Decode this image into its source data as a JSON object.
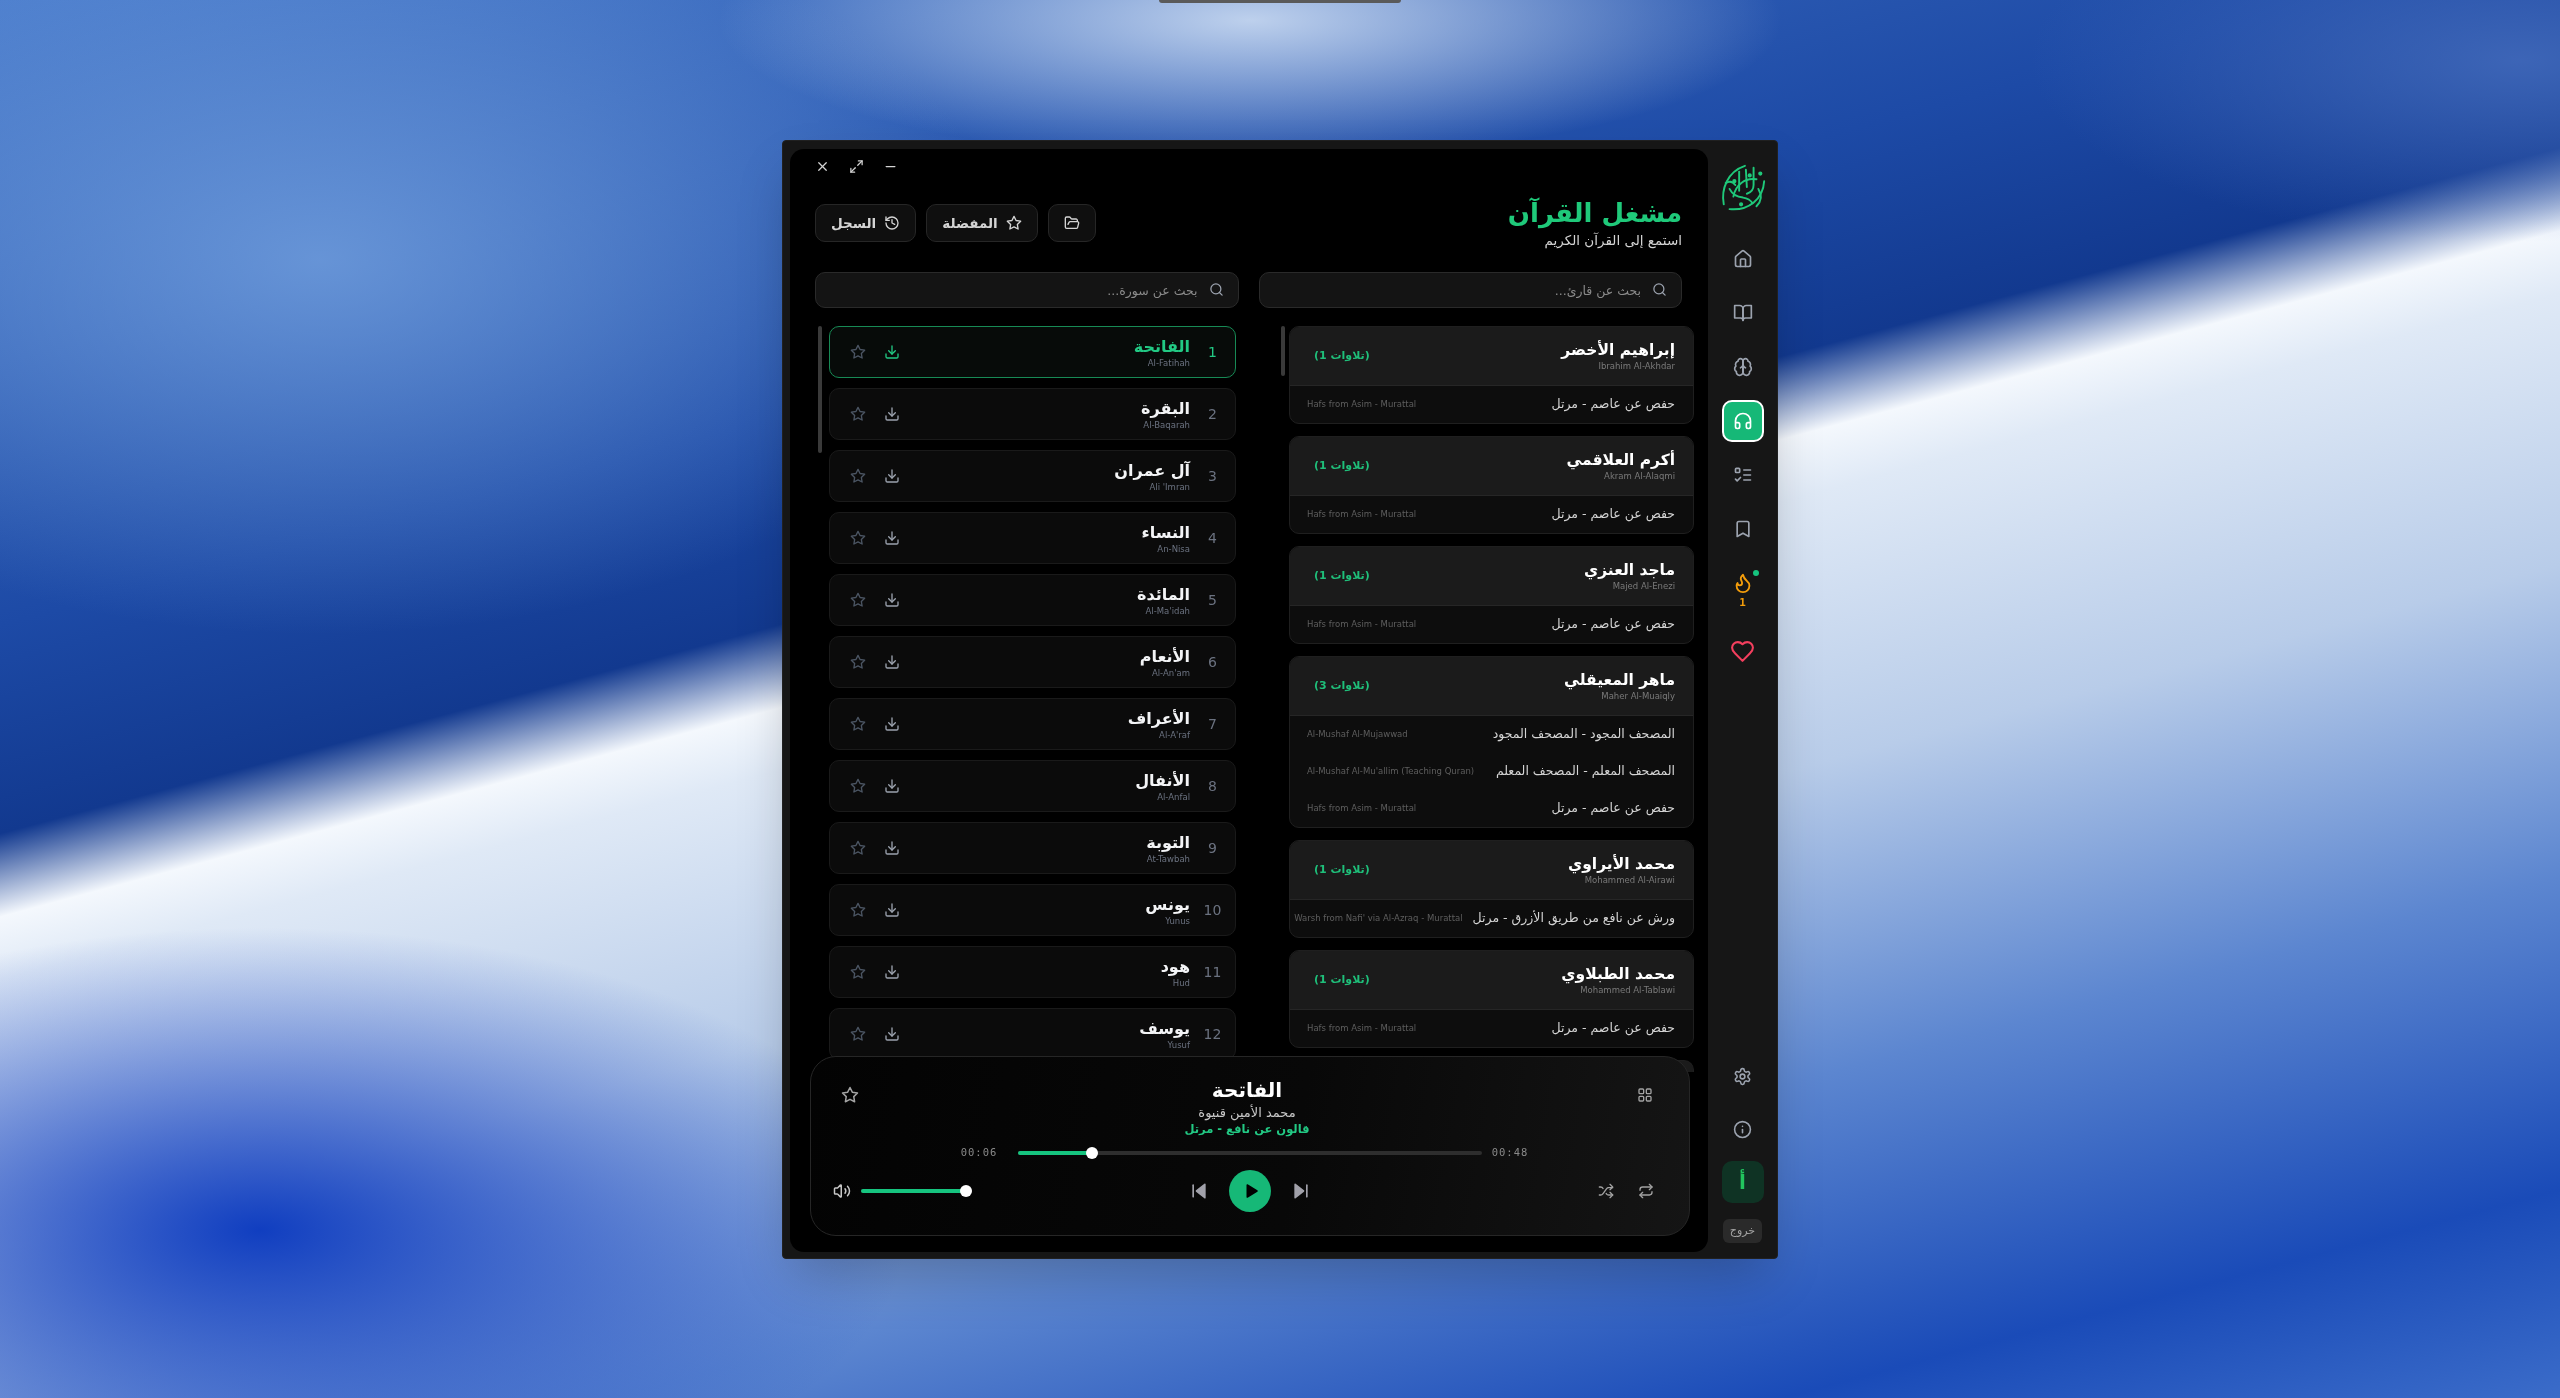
{
  "window": {
    "controls": [
      {
        "kind": "close"
      },
      {
        "kind": "maximize"
      },
      {
        "kind": "minimize"
      }
    ]
  },
  "sidebar": {
    "items": [
      {
        "kind": "home",
        "selected": false
      },
      {
        "kind": "read",
        "selected": false
      },
      {
        "kind": "learn",
        "selected": false
      },
      {
        "kind": "listen",
        "selected": true
      },
      {
        "kind": "tasks",
        "selected": false
      },
      {
        "kind": "bookmarks",
        "selected": false
      },
      {
        "kind": "streak",
        "selected": false,
        "count": "1",
        "notification": true
      },
      {
        "kind": "favorites",
        "selected": false
      }
    ],
    "footer_items": [
      {
        "kind": "settings"
      },
      {
        "kind": "about"
      }
    ],
    "profile": {
      "initial": "أ"
    },
    "logout": {
      "label": "خروج"
    }
  },
  "header": {
    "title": "مشغل القرآن",
    "subtitle": "استمع إلى القرآن الكريم",
    "buttons": [
      {
        "kind": "folder"
      },
      {
        "kind": "favorites",
        "label": "المفضلة"
      },
      {
        "kind": "history",
        "label": "السجل"
      }
    ]
  },
  "reciter_search": {
    "placeholder": "بحث عن قارئ..."
  },
  "surah_search": {
    "placeholder": "بحث عن سورة..."
  },
  "reciters": [
    {
      "name": "إبراهيم الأخضر",
      "transliteration": "Ibrahim Al-Akhdar",
      "count": "(1 تلاوات)",
      "recitations": [
        {
          "name": "حفص عن عاصم - مرتل",
          "transliteration": "Hafs from Asim - Murattal"
        }
      ]
    },
    {
      "name": "أكرم العلاقمي",
      "transliteration": "Akram Al-Alaqmi",
      "count": "(1 تلاوات)",
      "recitations": [
        {
          "name": "حفص عن عاصم - مرتل",
          "transliteration": "Hafs from Asim - Murattal"
        }
      ]
    },
    {
      "name": "ماجد العنزي",
      "transliteration": "Majed Al-Enezi",
      "count": "(1 تلاوات)",
      "recitations": [
        {
          "name": "حفص عن عاصم - مرتل",
          "transliteration": "Hafs from Asim - Murattal"
        }
      ]
    },
    {
      "name": "ماهر المعيقلي",
      "transliteration": "Maher Al-Muaiqly",
      "count": "(3 تلاوات)",
      "recitations": [
        {
          "name": "المصحف المجود - المصحف المجود",
          "transliteration": "Al-Mushaf Al-Mujawwad"
        },
        {
          "name": "المصحف المعلم - المصحف المعلم",
          "transliteration": "Al-Mushaf Al-Mu'allim (Teaching Quran)"
        },
        {
          "name": "حفص عن عاصم - مرتل",
          "transliteration": "Hafs from Asim - Murattal"
        }
      ]
    },
    {
      "name": "محمد الأيراوي",
      "transliteration": "Mohammed Al-Airawi",
      "count": "(1 تلاوات)",
      "recitations": [
        {
          "name": "ورش عن نافع من طريق الأزرق - مرتل",
          "transliteration": "Warsh from Nafi' via Al-Azraq - Murattal"
        }
      ]
    },
    {
      "name": "محمد الطبلاوي",
      "transliteration": "Mohammed Al-Tablawi",
      "count": "(1 تلاوات)",
      "recitations": [
        {
          "name": "حفص عن عاصم - مرتل",
          "transliteration": "Hafs from Asim - Murattal"
        }
      ]
    }
  ],
  "surahs": [
    {
      "number": "1",
      "name": "الفاتحة",
      "transliteration": "Al-Fatihah",
      "selected": true,
      "favorite": false
    },
    {
      "number": "2",
      "name": "البقرة",
      "transliteration": "Al-Baqarah",
      "selected": false,
      "favorite": false
    },
    {
      "number": "3",
      "name": "آل عمران",
      "transliteration": "Ali 'Imran",
      "selected": false,
      "favorite": false
    },
    {
      "number": "4",
      "name": "النساء",
      "transliteration": "An-Nisa",
      "selected": false,
      "favorite": false
    },
    {
      "number": "5",
      "name": "المائدة",
      "transliteration": "Al-Ma'idah",
      "selected": false,
      "favorite": false
    },
    {
      "number": "6",
      "name": "الأنعام",
      "transliteration": "Al-An'am",
      "selected": false,
      "favorite": false
    },
    {
      "number": "7",
      "name": "الأعراف",
      "transliteration": "Al-A'raf",
      "selected": false,
      "favorite": false
    },
    {
      "number": "8",
      "name": "الأنفال",
      "transliteration": "Al-Anfal",
      "selected": false,
      "favorite": false
    },
    {
      "number": "9",
      "name": "التوبة",
      "transliteration": "At-Tawbah",
      "selected": false,
      "favorite": false
    },
    {
      "number": "10",
      "name": "يونس",
      "transliteration": "Yunus",
      "selected": false,
      "favorite": false
    },
    {
      "number": "11",
      "name": "هود",
      "transliteration": "Hud",
      "selected": false,
      "favorite": false
    },
    {
      "number": "12",
      "name": "يوسف",
      "transliteration": "Yusuf",
      "selected": false,
      "favorite": false
    }
  ],
  "player": {
    "favorite": false,
    "title": "الفاتحة",
    "reciter": "محمد الأمين قنيوة",
    "riwaya": "قالون عن نافع - مرتل",
    "elapsed": "00:06",
    "duration": "00:48",
    "progress": {
      "level": 0.15
    },
    "volume": {
      "level": 1
    },
    "playing": false
  }
}
